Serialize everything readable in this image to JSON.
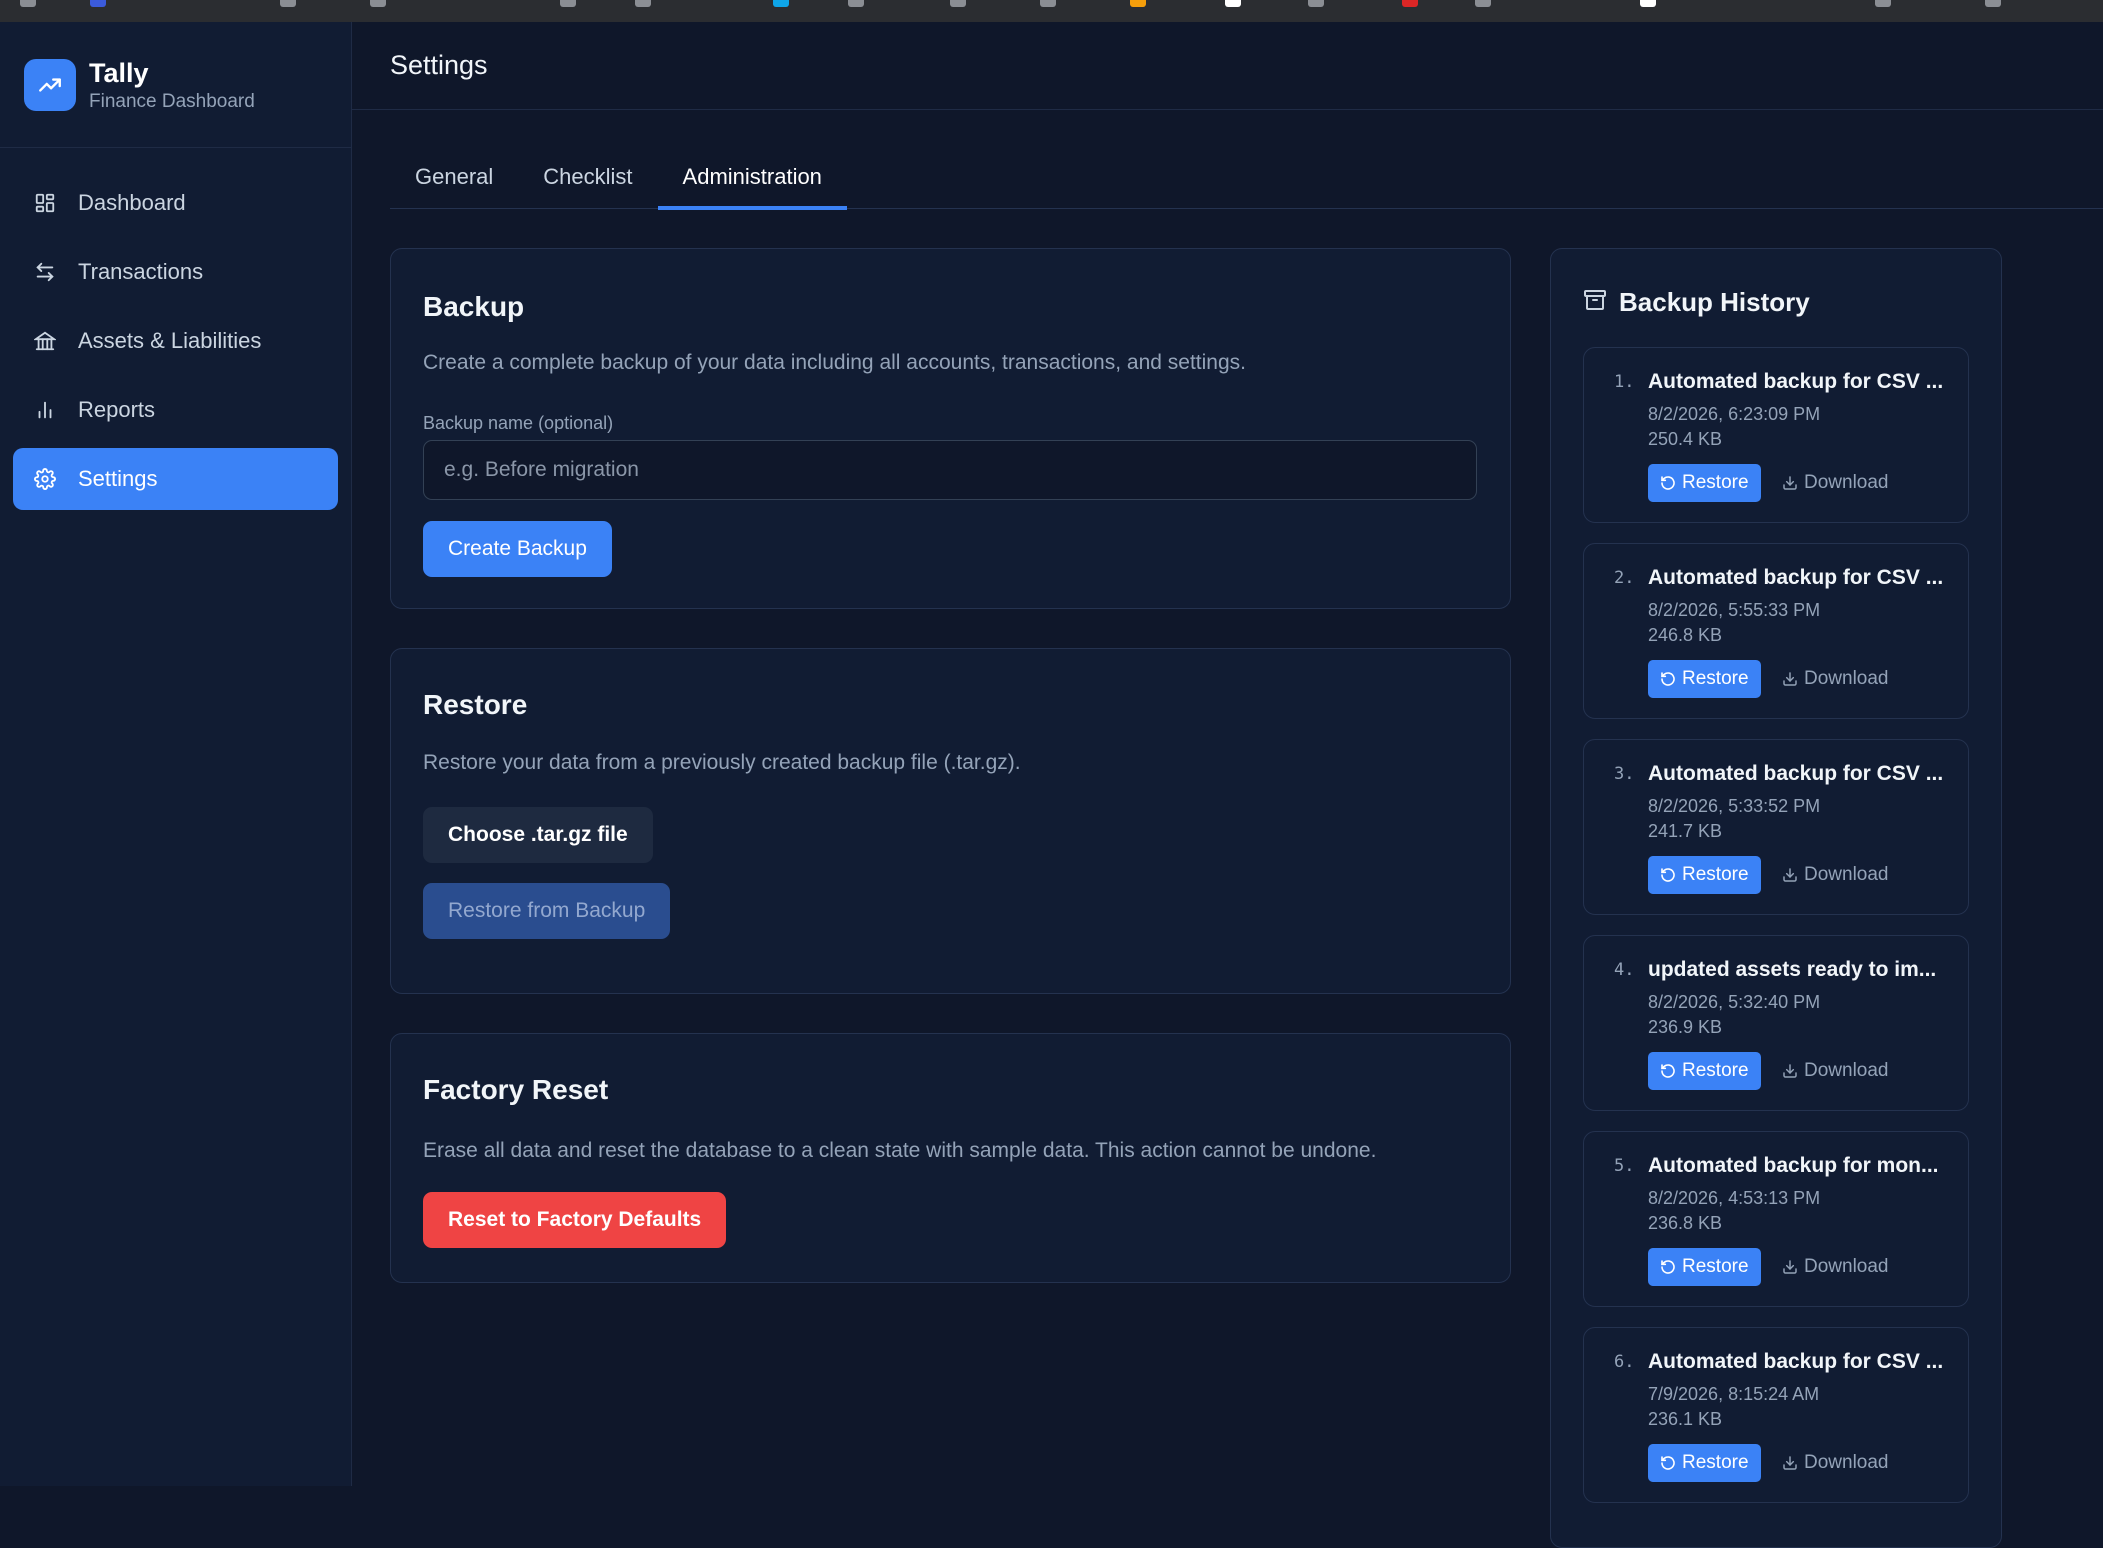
{
  "app": {
    "name": "Tally",
    "subtitle": "Finance Dashboard"
  },
  "sidebar": {
    "items": [
      {
        "label": "Dashboard",
        "icon": "dashboard-grid-icon"
      },
      {
        "label": "Transactions",
        "icon": "arrows-left-right-icon"
      },
      {
        "label": "Assets & Liabilities",
        "icon": "bank-icon"
      },
      {
        "label": "Reports",
        "icon": "bar-chart-icon"
      },
      {
        "label": "Settings",
        "icon": "gear-icon",
        "active": true
      }
    ]
  },
  "header": {
    "title": "Settings"
  },
  "tabs": [
    {
      "label": "General"
    },
    {
      "label": "Checklist"
    },
    {
      "label": "Administration",
      "active": true
    }
  ],
  "backup": {
    "title": "Backup",
    "description": "Create a complete backup of your data including all accounts, transactions, and settings.",
    "name_label": "Backup name (optional)",
    "name_placeholder": "e.g. Before migration",
    "name_value": "",
    "create_label": "Create Backup"
  },
  "restore": {
    "title": "Restore",
    "description": "Restore your data from a previously created backup file (.tar.gz).",
    "choose_label": "Choose .tar.gz file",
    "restore_label": "Restore from Backup"
  },
  "reset": {
    "title": "Factory Reset",
    "description": "Erase all data and reset the database to a clean state with sample data. This action cannot be undone.",
    "button_label": "Reset to Factory Defaults"
  },
  "history": {
    "title": "Backup History",
    "restore_label": "Restore",
    "download_label": "Download",
    "items": [
      {
        "num": "1.",
        "title": "Automated backup for CSV ...",
        "date": "8/2/2026, 6:23:09 PM",
        "size": "250.4 KB"
      },
      {
        "num": "2.",
        "title": "Automated backup for CSV ...",
        "date": "8/2/2026, 5:55:33 PM",
        "size": "246.8 KB"
      },
      {
        "num": "3.",
        "title": "Automated backup for CSV ...",
        "date": "8/2/2026, 5:33:52 PM",
        "size": "241.7 KB"
      },
      {
        "num": "4.",
        "title": "updated assets ready to im...",
        "date": "8/2/2026, 5:32:40 PM",
        "size": "236.9 KB"
      },
      {
        "num": "5.",
        "title": "Automated backup for mon...",
        "date": "8/2/2026, 4:53:13 PM",
        "size": "236.8 KB"
      },
      {
        "num": "6.",
        "title": "Automated backup for CSV ...",
        "date": "7/9/2026, 8:15:24 AM",
        "size": "236.1 KB"
      }
    ]
  },
  "colors": {
    "accent": "#3b82f6",
    "danger": "#ef4444",
    "background": "#0f172a",
    "panel": "#111c33"
  }
}
